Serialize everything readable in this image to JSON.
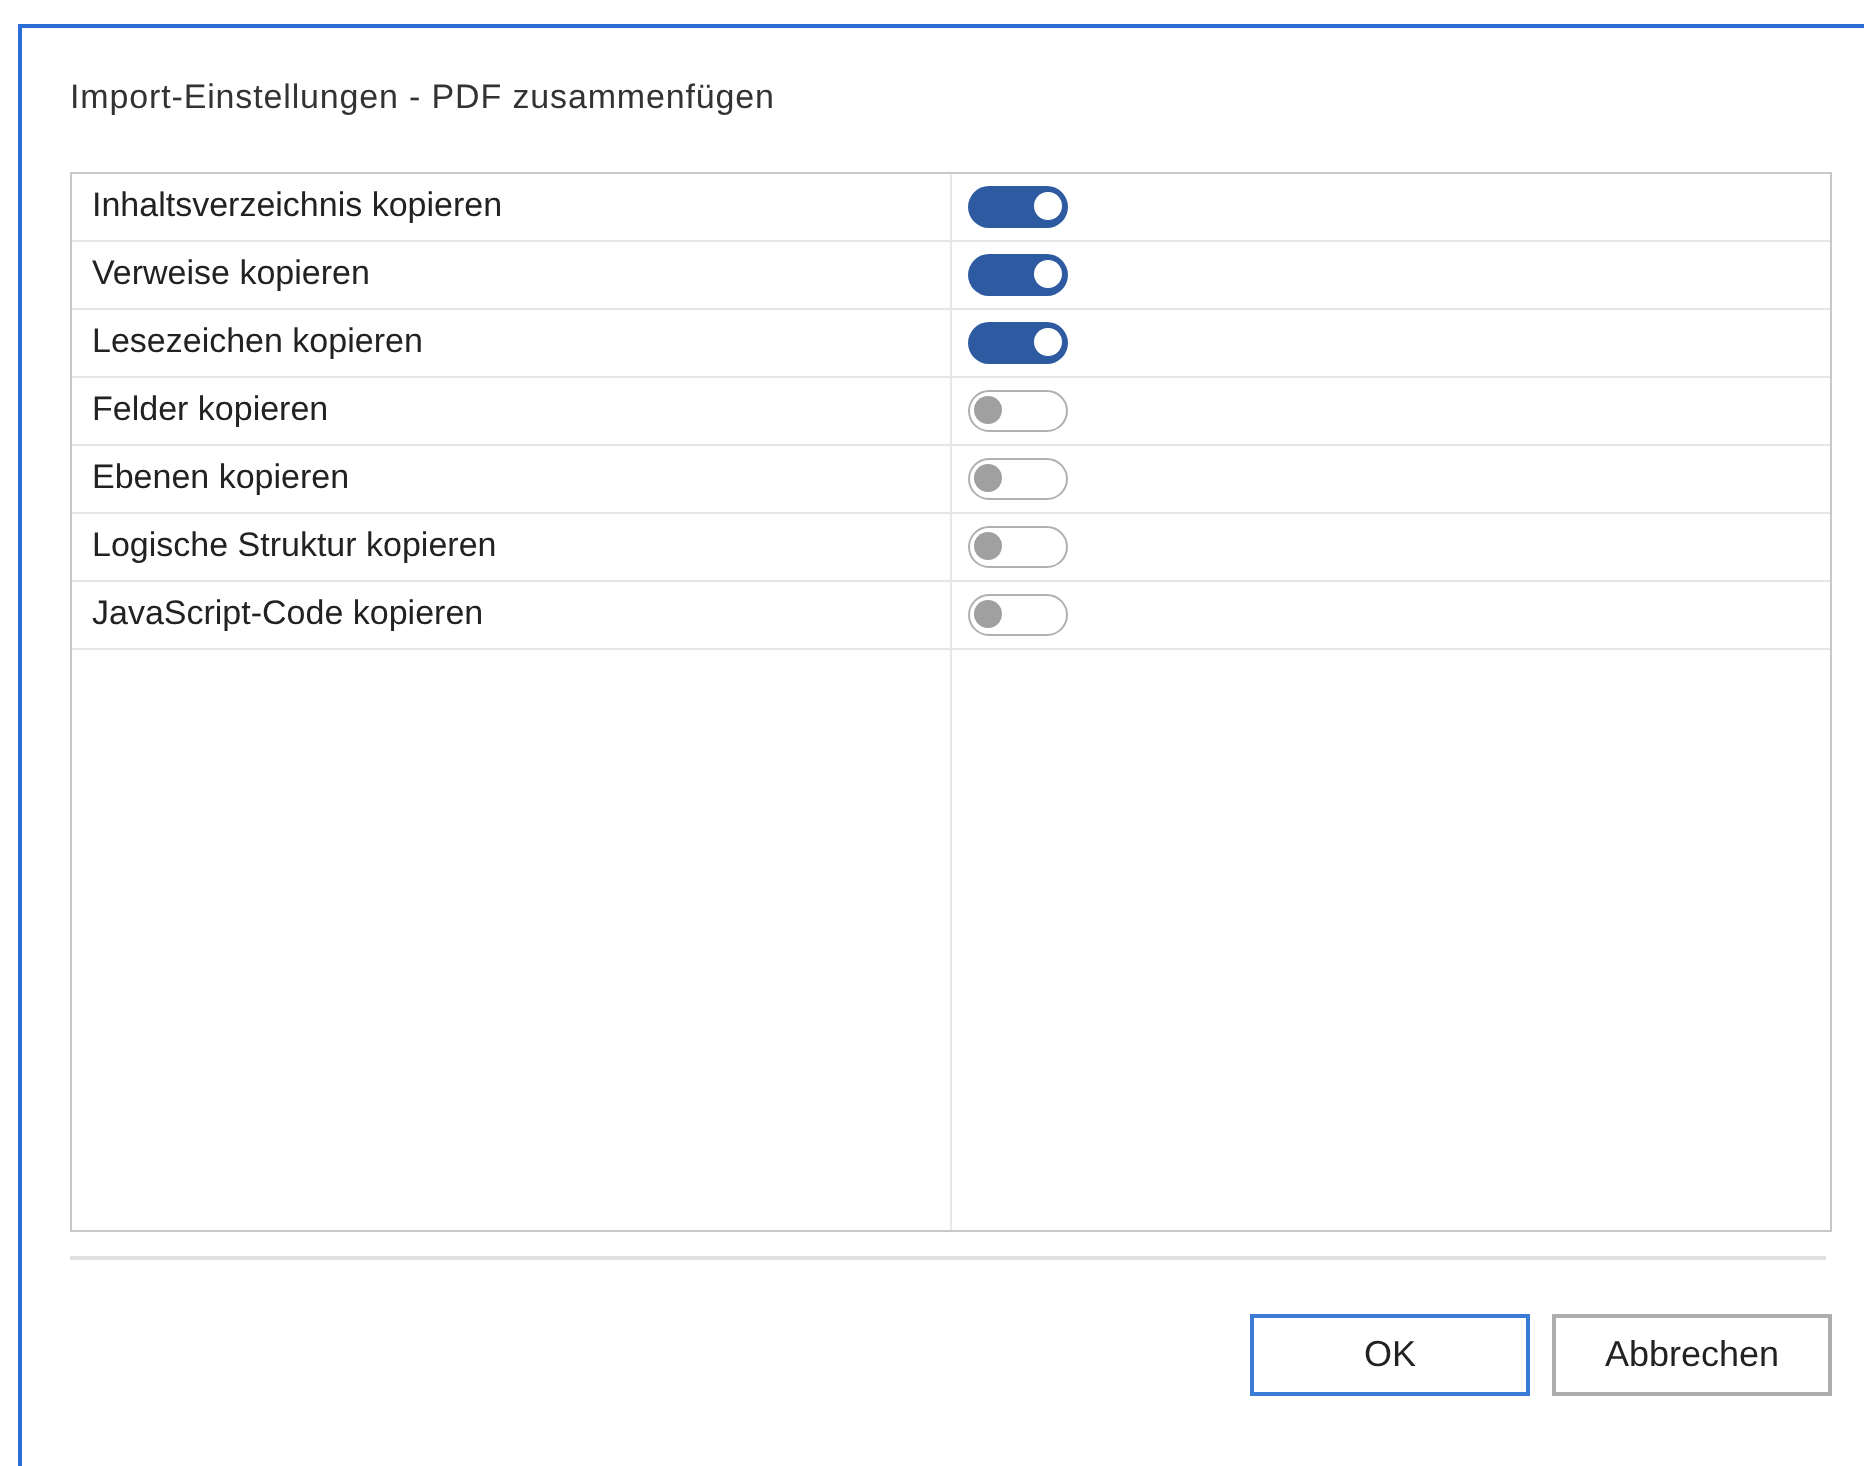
{
  "dialog": {
    "title": "Import-Einstellungen - PDF zusammenfügen"
  },
  "options": [
    {
      "label": "Inhaltsverzeichnis kopieren",
      "on": true
    },
    {
      "label": "Verweise kopieren",
      "on": true
    },
    {
      "label": "Lesezeichen kopieren",
      "on": true
    },
    {
      "label": "Felder kopieren",
      "on": false
    },
    {
      "label": "Ebenen kopieren",
      "on": false
    },
    {
      "label": "Logische Struktur kopieren",
      "on": false
    },
    {
      "label": "JavaScript-Code kopieren",
      "on": false
    }
  ],
  "buttons": [
    {
      "label": "OK",
      "default": true
    },
    {
      "label": "Abbrechen",
      "default": false
    }
  ]
}
